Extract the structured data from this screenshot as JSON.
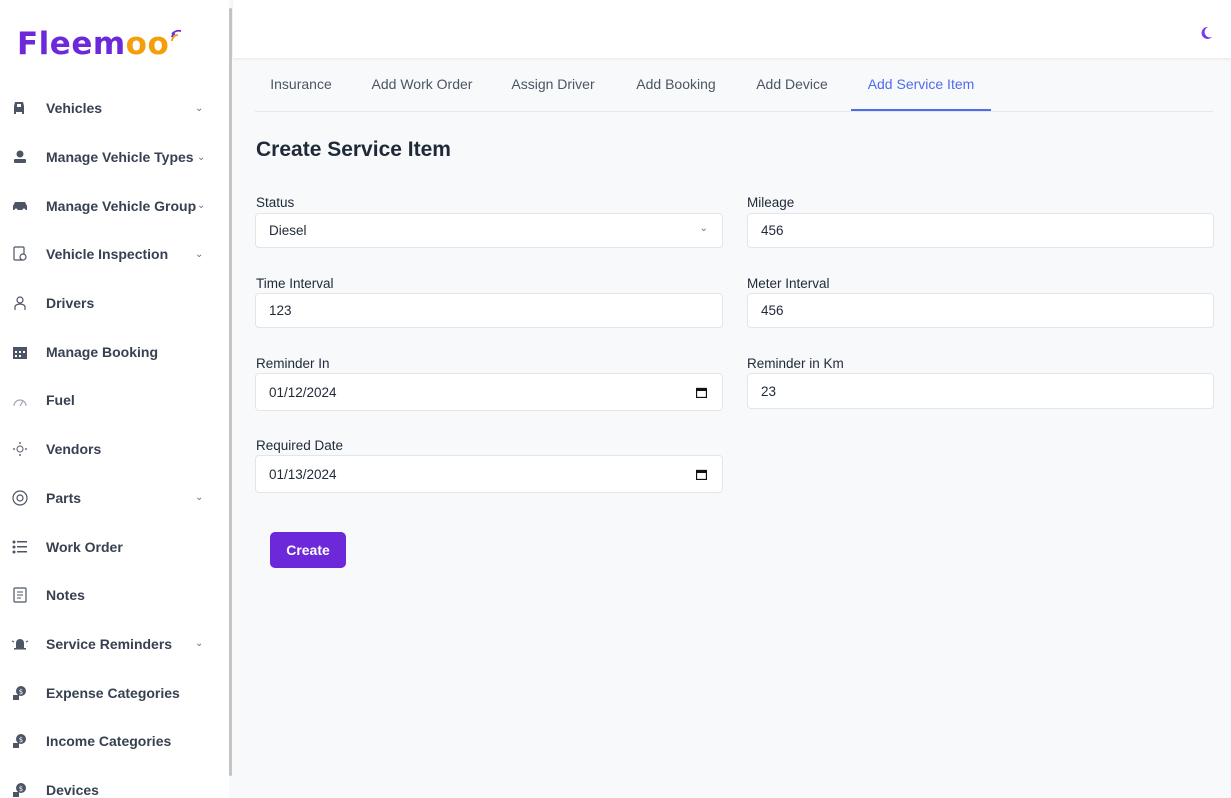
{
  "brand": {
    "logo_main": "Fleem",
    "logo_accent": "oo"
  },
  "colors": {
    "accent": "#6d28d9",
    "tab_active": "#4f6bed",
    "logo_accent": "#f59e0b"
  },
  "sidebar": {
    "items": [
      {
        "label": "Vehicles",
        "icon": "car-icon",
        "has_chevron": true
      },
      {
        "label": "Manage Vehicle Types",
        "icon": "vehicle-type-icon",
        "has_chevron": true
      },
      {
        "label": "Manage Vehicle Group",
        "icon": "vehicle-group-icon",
        "has_chevron": true
      },
      {
        "label": "Vehicle Inspection",
        "icon": "inspection-icon",
        "has_chevron": true
      },
      {
        "label": "Drivers",
        "icon": "driver-icon",
        "has_chevron": false
      },
      {
        "label": "Manage Booking",
        "icon": "calendar-icon",
        "has_chevron": false
      },
      {
        "label": "Fuel",
        "icon": "fuel-icon",
        "has_chevron": false
      },
      {
        "label": "Vendors",
        "icon": "vendors-icon",
        "has_chevron": false
      },
      {
        "label": "Parts",
        "icon": "parts-icon",
        "has_chevron": true
      },
      {
        "label": "Work Order",
        "icon": "work-order-icon",
        "has_chevron": false
      },
      {
        "label": "Notes",
        "icon": "notes-icon",
        "has_chevron": false
      },
      {
        "label": "Service Reminders",
        "icon": "bell-icon",
        "has_chevron": true
      },
      {
        "label": "Expense Categories",
        "icon": "expense-icon",
        "has_chevron": false
      },
      {
        "label": "Income Categories",
        "icon": "income-icon",
        "has_chevron": false
      },
      {
        "label": "Devices",
        "icon": "devices-icon",
        "has_chevron": false
      }
    ],
    "chevron": "⌄"
  },
  "topbar": {
    "theme_icon": "moon-icon"
  },
  "tabs": [
    {
      "label": "Insurance",
      "active": false
    },
    {
      "label": "Add Work Order",
      "active": false
    },
    {
      "label": "Assign Driver",
      "active": false
    },
    {
      "label": "Add Booking",
      "active": false
    },
    {
      "label": "Add Device",
      "active": false
    },
    {
      "label": "Add Service Item",
      "active": true
    }
  ],
  "form": {
    "title": "Create Service Item",
    "status": {
      "label": "Status",
      "value": "Diesel"
    },
    "mileage": {
      "label": "Mileage",
      "value": "456"
    },
    "time_interval": {
      "label": "Time Interval",
      "value": "123"
    },
    "meter_interval": {
      "label": "Meter Interval",
      "value": "456"
    },
    "reminder_in": {
      "label": "Reminder In",
      "value": "01/12/2024"
    },
    "reminder_km": {
      "label": "Reminder in Km",
      "value": "23"
    },
    "required_date": {
      "label": "Required Date",
      "value": "01/13/2024"
    },
    "submit_label": "Create"
  }
}
